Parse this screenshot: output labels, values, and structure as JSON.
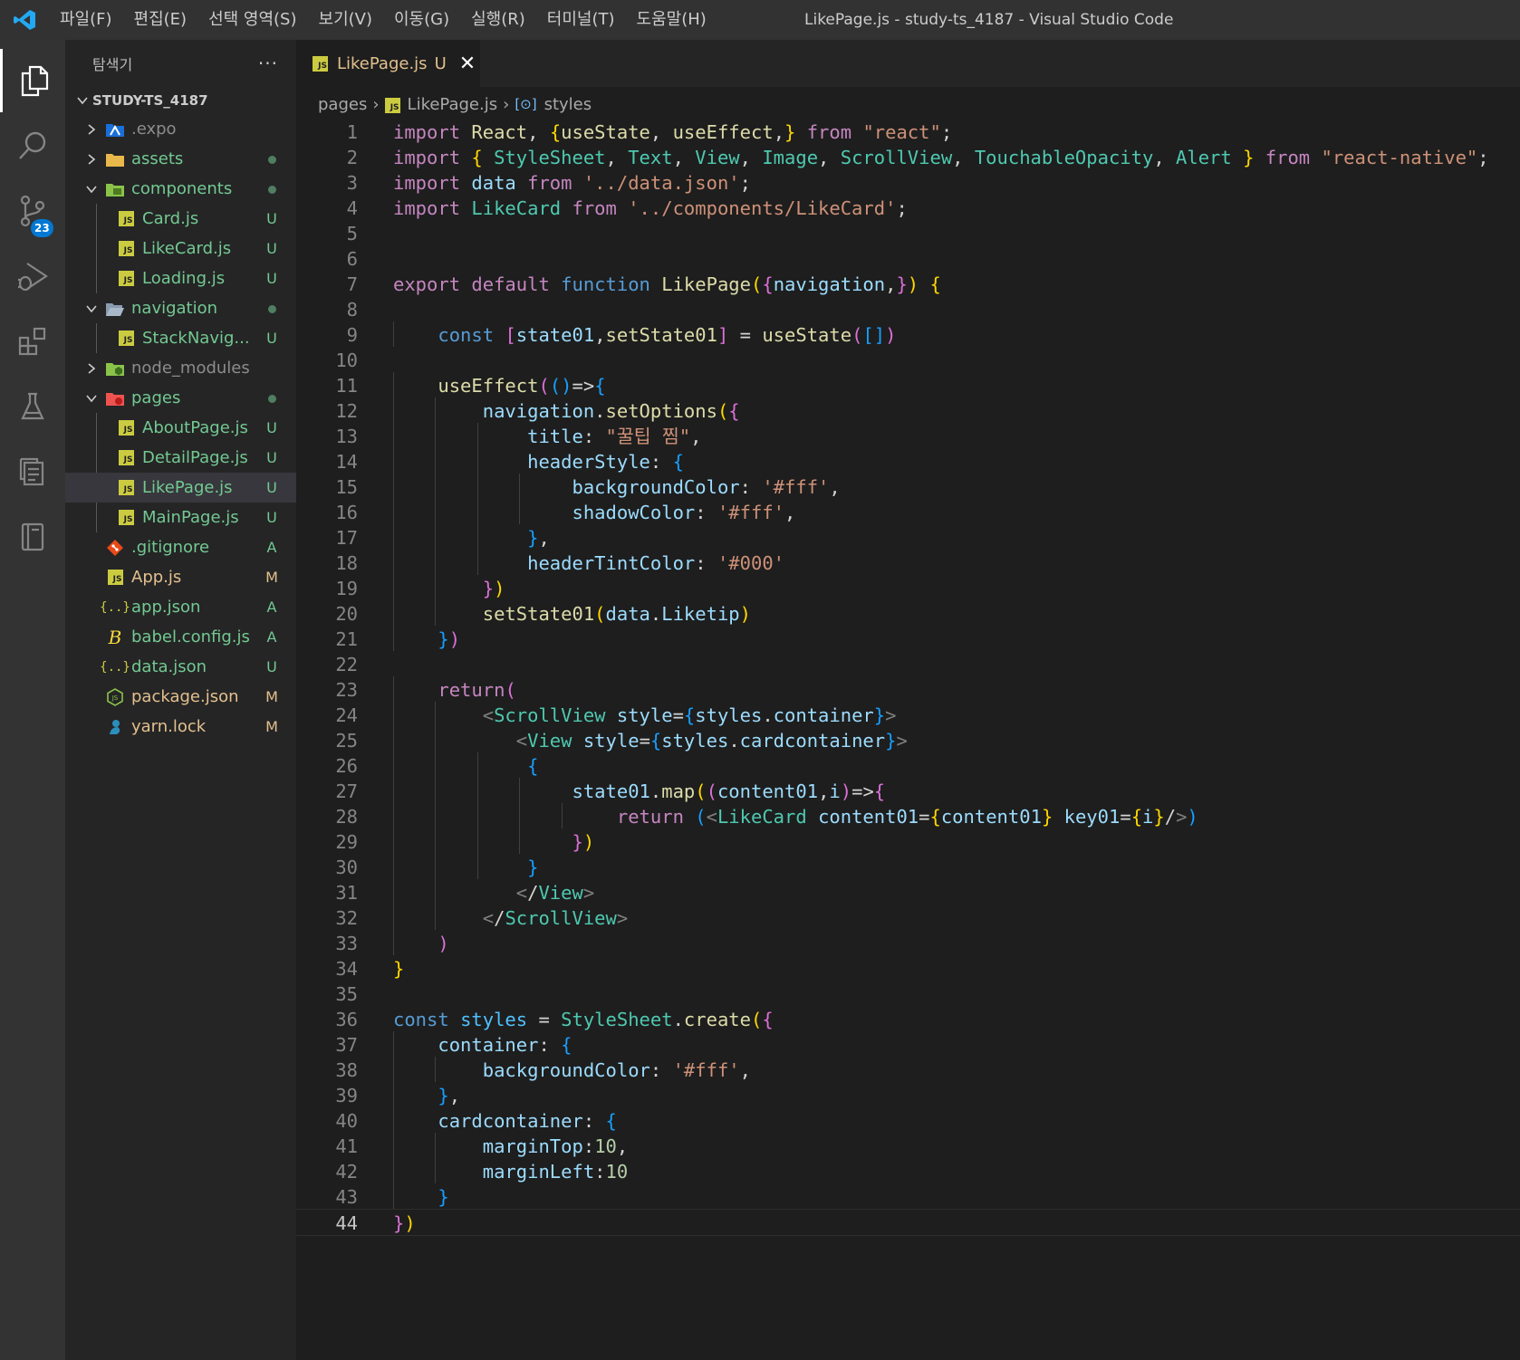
{
  "window_title": "LikePage.js - study-ts_4187 - Visual Studio Code",
  "menu": [
    "파일(F)",
    "편집(E)",
    "선택 영역(S)",
    "보기(V)",
    "이동(G)",
    "실행(R)",
    "터미널(T)",
    "도움말(H)"
  ],
  "activity_bar": {
    "items": [
      "explorer-icon",
      "search-icon",
      "source-control-icon",
      "run-debug-icon",
      "extensions-icon",
      "testing-icon",
      "remote-explorer-icon",
      "notebook-icon"
    ],
    "source_control_badge": "23"
  },
  "explorer": {
    "title": "탐색기",
    "more": "···",
    "root": "STUDY-TS_4187",
    "items": [
      {
        "name": ".expo",
        "status": ""
      },
      {
        "name": "assets",
        "status": "•"
      },
      {
        "name": "components",
        "status": "•"
      },
      {
        "name": "Card.js",
        "status": "U"
      },
      {
        "name": "LikeCard.js",
        "status": "U"
      },
      {
        "name": "Loading.js",
        "status": "U"
      },
      {
        "name": "navigation",
        "status": "•"
      },
      {
        "name": "StackNavig...",
        "status": "U"
      },
      {
        "name": "node_modules",
        "status": ""
      },
      {
        "name": "pages",
        "status": "•"
      },
      {
        "name": "AboutPage.js",
        "status": "U"
      },
      {
        "name": "DetailPage.js",
        "status": "U"
      },
      {
        "name": "LikePage.js",
        "status": "U"
      },
      {
        "name": "MainPage.js",
        "status": "U"
      },
      {
        "name": ".gitignore",
        "status": "A"
      },
      {
        "name": "App.js",
        "status": "M"
      },
      {
        "name": "app.json",
        "status": "A"
      },
      {
        "name": "babel.config.js",
        "status": "A"
      },
      {
        "name": "data.json",
        "status": "U"
      },
      {
        "name": "package.json",
        "status": "M"
      },
      {
        "name": "yarn.lock",
        "status": "M"
      }
    ]
  },
  "tab": {
    "label": "LikePage.js",
    "status": "U"
  },
  "breadcrumb": [
    "pages",
    "LikePage.js",
    "styles"
  ],
  "editor": {
    "current_line": 44,
    "lines": [
      "import React, {useState, useEffect,} from \"react\";",
      "import { StyleSheet, Text, View, Image, ScrollView, TouchableOpacity, Alert } from \"react-native\";",
      "import data from '../data.json';",
      "import LikeCard from '../components/LikeCard';",
      "",
      "",
      "export default function LikePage({navigation,}) {",
      "",
      "    const [state01,setState01] = useState([])",
      "",
      "    useEffect(()=>{",
      "        navigation.setOptions({",
      "            title: \"꿀팁 찜\",",
      "            headerStyle: {",
      "                backgroundColor: '#fff',",
      "                shadowColor: '#fff',",
      "            },",
      "            headerTintColor: '#000'",
      "        })",
      "        setState01(data.Liketip)",
      "    })",
      "",
      "    return(",
      "        <ScrollView style={styles.container}>",
      "           <View style={styles.cardcontainer}>",
      "            {",
      "                state01.map((content01,i)=>{",
      "                    return (<LikeCard content01={content01} key01={i}/>)",
      "                })",
      "            }",
      "           </View>",
      "        </ScrollView>",
      "    )",
      "}",
      "",
      "const styles = StyleSheet.create({",
      "    container: {",
      "        backgroundColor: '#fff',",
      "    },",
      "    cardcontainer: {",
      "        marginTop:10,",
      "        marginLeft:10",
      "    }",
      "})"
    ]
  }
}
